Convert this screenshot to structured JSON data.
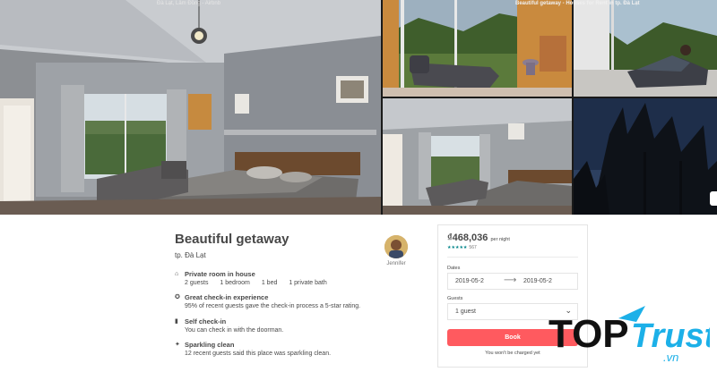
{
  "window": {
    "left_caption": "Đà Lạt, Lâm Đồng - Airbnb",
    "right_caption": "Beautiful getaway - Houses for Rent in tp. Đà Lạt"
  },
  "listing": {
    "title": "Beautiful getaway",
    "city": "tp. Đà Lạt",
    "host_name": "Jennifer"
  },
  "features": [
    {
      "icon": "house-icon",
      "title": "Private room in house",
      "details": [
        "2 guests",
        "1 bedroom",
        "1 bed",
        "1 private bath"
      ]
    },
    {
      "icon": "medal-icon",
      "title": "Great check-in experience",
      "description": "95% of recent guests gave the check-in process a 5-star rating."
    },
    {
      "icon": "door-icon",
      "title": "Self check-in",
      "description": "You can check in with the doorman."
    },
    {
      "icon": "sparkle-icon",
      "title": "Sparkling clean",
      "description": "12 recent guests said this place was sparkling clean."
    }
  ],
  "booking": {
    "price": "₫468,036",
    "per_night": "per night",
    "stars": "★★★★★",
    "review_count": "567",
    "dates_label": "Dates",
    "check_in": "2019-05-2",
    "check_out": "2019-05-2",
    "guests_label": "Guests",
    "guests_value": "1 guest",
    "book_label": "Book",
    "no_charge": "You won't be charged yet"
  },
  "watermark": {
    "top": "TOP",
    "trust": "Trust",
    "domain": ".vn"
  },
  "colors": {
    "accent": "#ff5a5f",
    "teal": "#008489",
    "text": "#484848",
    "muted": "#767676"
  }
}
